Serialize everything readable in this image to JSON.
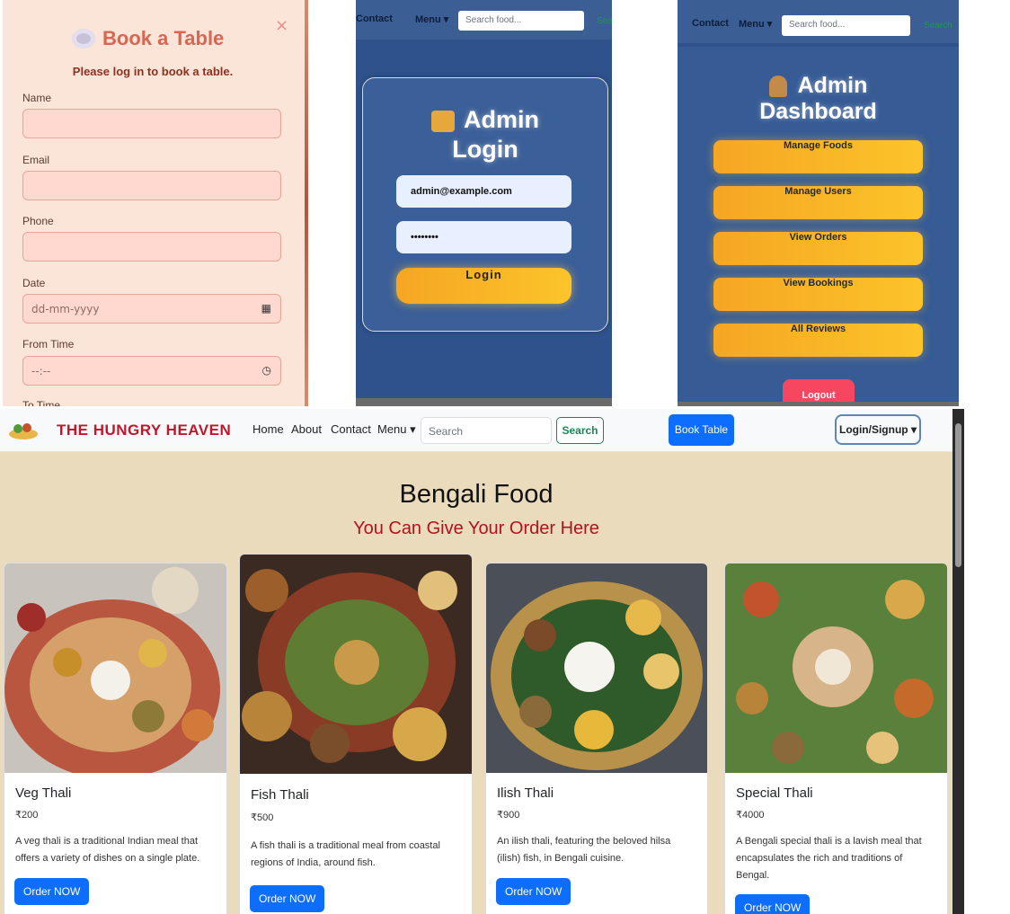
{
  "book_form": {
    "close": "×",
    "title": "Book a Table",
    "message": "Please log in to book a table.",
    "fields": [
      {
        "label": "Name",
        "value": ""
      },
      {
        "label": "Email",
        "value": ""
      },
      {
        "label": "Phone",
        "value": ""
      },
      {
        "label": "Date",
        "value": "dd-mm-yyyy"
      },
      {
        "label": "From Time",
        "value": "--:--"
      },
      {
        "label": "To Time",
        "value": ""
      }
    ]
  },
  "mini_nav_login": {
    "links": [
      "Contact",
      "Menu ▾"
    ],
    "search_placeholder": "Search food...",
    "search_label": "Search"
  },
  "admin_login": {
    "title_line1": "Admin",
    "title_line2": "Login",
    "email_value": "admin@example.com",
    "password_value": "••••••••",
    "login_label": "Login"
  },
  "mini_nav_dash": {
    "links": [
      "Contact",
      "Menu ▾"
    ],
    "search_placeholder": "Search food...",
    "search_label": "Search"
  },
  "admin_dashboard": {
    "title_line1": "Admin",
    "title_line2": "Dashboard",
    "buttons": [
      "Manage Foods",
      "Manage Users",
      "View Orders",
      "View Bookings",
      "All Reviews"
    ],
    "logout_label": "Logout"
  },
  "site": {
    "brand": "THE HUNGRY HEAVEN",
    "nav_links": [
      "Home",
      "About",
      "Contact",
      "Menu ▾"
    ],
    "search_placeholder": "Search",
    "search_button": "Search",
    "book_table": "Book Table",
    "login_signup": "Login/Signup ▾",
    "heading": "Bengali Food",
    "subheading": "You Can Give Your Order Here",
    "cards": [
      {
        "name": "Veg Thali",
        "price": "₹200",
        "description": "A veg thali is a traditional Indian meal that offers a variety of dishes on a single plate.",
        "button": "Order NOW"
      },
      {
        "name": "Fish Thali",
        "price": "₹500",
        "description": "A fish thali is a traditional meal from coastal regions of India, around fish.",
        "button": "Order NOW"
      },
      {
        "name": "Ilish Thali",
        "price": "₹900",
        "description": "An ilish thali, featuring the beloved hilsa (ilish) fish, in Bengali cuisine.",
        "button": "Order NOW"
      },
      {
        "name": "Special Thali",
        "price": "₹4000",
        "description": "A Bengali special thali is a lavish meal that encapsulates the rich and traditions of Bengal.",
        "button": "Order NOW"
      }
    ]
  },
  "colors": {
    "brand_red": "#c0172d",
    "primary_blue": "#0d6efd",
    "search_green": "#198754",
    "admin_bg": "#2f528c",
    "accent_orange": "#f5a623"
  }
}
